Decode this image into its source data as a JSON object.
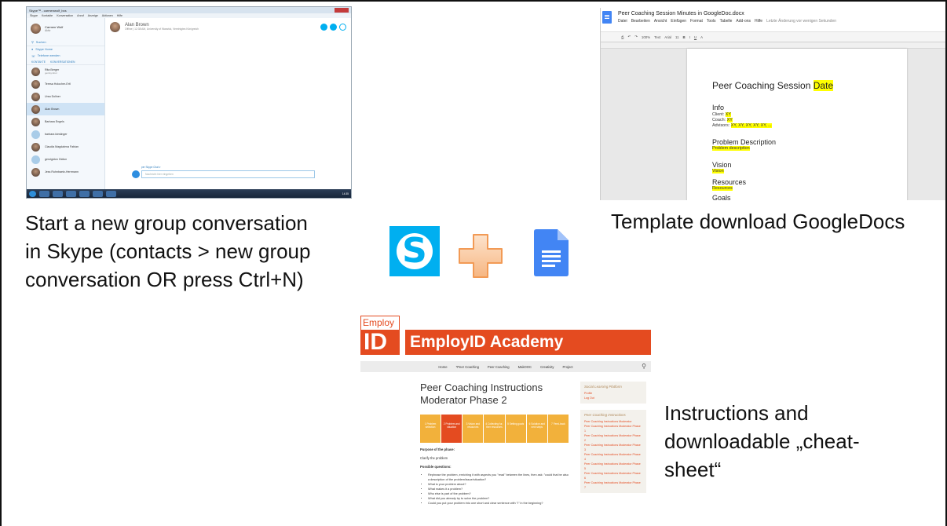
{
  "skype": {
    "window_title": "Skype™ - carmenwolf_bcs",
    "menu": [
      "Skype",
      "Kontakte",
      "Konversation",
      "Anruf",
      "Anzeige",
      "Aktionen",
      "Hilfe"
    ],
    "me": {
      "name": "Carmen Wolf",
      "status": "Aktiv"
    },
    "search_label": "Suchen",
    "nav": [
      "Skype Home",
      "Telefone wenden"
    ],
    "tabs": [
      "KONTAKTE",
      "KONVERSATIONEN"
    ],
    "contacts": [
      {
        "name": "Rita Berger",
        "sub": "gerdsymbol"
      },
      {
        "name": "Teresa Holocher-Ertl",
        "sub": ""
      },
      {
        "name": "Ursa Dollner",
        "sub": ""
      },
      {
        "name": "Alan Brown",
        "sub": "",
        "active": true
      },
      {
        "name": "Barbara Engels",
        "sub": ""
      },
      {
        "name": "barbara kieslinger",
        "sub": ""
      },
      {
        "name": "Claudia Magdalena Fabian",
        "sub": ""
      },
      {
        "name": "gerolgidon Gidion",
        "sub": ""
      },
      {
        "name": "Jess Ruhnbaetz-Herrmann",
        "sub": ""
      }
    ],
    "conversation": {
      "name": "Alan Brown",
      "sub": "Offline | 12:38 AM, University of Warwick, Vereinigtes Königreich"
    },
    "input_placeholder": "Nachricht hier eingeben",
    "input_hint": "per Skype Chat ▾",
    "clock": "14:35"
  },
  "gdoc": {
    "title": "Peer Coaching Session Minutes in GoogleDoc.docx",
    "menu": [
      "Datei",
      "Bearbeiten",
      "Ansicht",
      "Einfügen",
      "Format",
      "Tools",
      "Tabelle",
      "Add-ons",
      "Hilfe"
    ],
    "last_edit": "Letzte Änderung vor wenigen Sekunden",
    "toolbar": [
      "100%",
      "Text",
      "Arial",
      "11",
      "B",
      "I",
      "U",
      "A"
    ],
    "heading_main": "Peer Coaching Session",
    "heading_date": "Date",
    "info_heading": "Info",
    "client_label": "Client:",
    "client_value": "XY",
    "coach_label": "Coach:",
    "coach_value": "XY",
    "advisors_label": "Advisors:",
    "advisors_value": "XY, XY, XY, XY, XY, ...",
    "problem_heading": "Problem Description",
    "problem_value": "Problem description",
    "vision_heading": "Vision",
    "vision_value": "Vision",
    "resources_heading": "Resources",
    "resources_value": "Resources",
    "goals_heading": "Goals"
  },
  "captions": {
    "skype_line1": "Start a new group conversation",
    "skype_line2": "in Skype (contacts > new group",
    "skype_line3": "conversation OR press Ctrl+N)",
    "gdoc": "Template download GoogleDocs",
    "emp_line1": "Instructions and",
    "emp_line2": "downloadable „cheat-",
    "emp_line3": "sheet“"
  },
  "logos": {
    "skype_letter": "S",
    "skype_color": "#00aff0",
    "plus_color": "#f9c9a0",
    "docs_color": "#4285f4"
  },
  "employid": {
    "logo_top": "Employ",
    "logo_bottom": "ID",
    "banner": "EmployID Academy",
    "nav": [
      "Home",
      "*Peer Coaching",
      "Peer Coaching",
      "MakOOC",
      "Creativity",
      "Project"
    ],
    "page_title_line1": "Peer Coaching Instructions",
    "page_title_line2": "Moderator Phase 2",
    "steps": [
      "1 Problem selection",
      "2 Problem and situation",
      "3 Vision and resources",
      "4 Collecting fur-ther resources",
      "5 Setting goals",
      "6 Solution and next steps",
      "7 Feed-back"
    ],
    "purpose_heading": "Purpose of the phase:",
    "purpose_text": "Clarify the problem",
    "questions_heading": "Possible questions:",
    "questions": [
      "Rephrase the problem, enriching it with aspects you \"read\" between the lines, then ask: \"could that be also a description of the problem/issue/situation?",
      "What is your problem about?",
      "What makes it a problem?",
      "Who else is part of the problem?",
      "What did you already try to solve the problem?",
      "Could you put your problem into one short and clear sentence with \"I\" in the beginning?"
    ],
    "side_platform_heading": "Social Learning Platform",
    "side_platform_links": [
      "Profile",
      "Log Out"
    ],
    "side_instr_heading": "Peer Coaching Instructions",
    "side_instr_links": [
      "Peer Coaching Instructions Moderator",
      "Peer Coaching Instructions Moderator Phase 1",
      "Peer Coaching Instructions Moderator Phase 2",
      "Peer Coaching Instructions Moderator Phase 3",
      "Peer Coaching Instructions Moderator Phase 4",
      "Peer Coaching Instructions Moderator Phase 5",
      "Peer Coaching Instructions Moderator Phase 6",
      "Peer Coaching Instructions Moderator Phase 7"
    ]
  }
}
